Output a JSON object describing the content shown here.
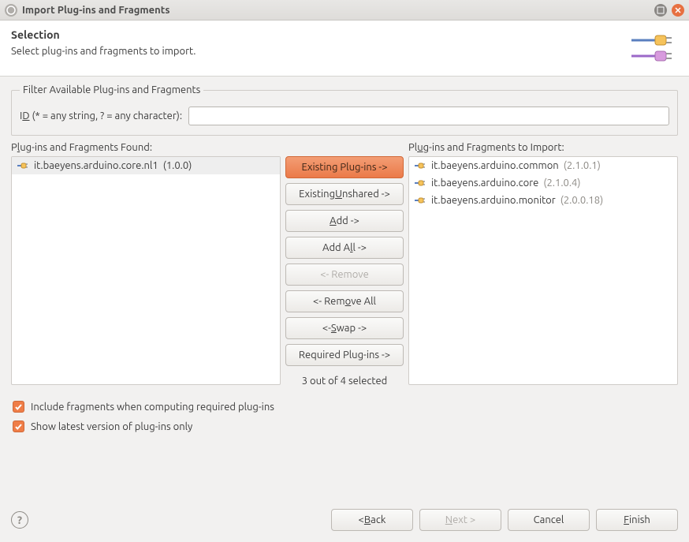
{
  "window": {
    "title": "Import Plug-ins and Fragments"
  },
  "header": {
    "title": "Selection",
    "desc": "Select plug-ins and fragments to import."
  },
  "filter": {
    "legend": "Filter Available Plug-ins and Fragments",
    "id_label_pre": "I",
    "id_label_u": "D",
    "id_label_post": " (* = any string, ? = any character):",
    "value": ""
  },
  "left": {
    "label_pre": "P",
    "label_u": "l",
    "label_post": "ug-ins and Fragments Found:",
    "items": [
      {
        "name": "it.baeyens.arduino.core.nl1",
        "version": "(1.0.0)",
        "selected": true
      }
    ]
  },
  "right": {
    "label_pre": "Pl",
    "label_u": "u",
    "label_post": "g-ins and Fragments to Import:",
    "items": [
      {
        "name": "it.baeyens.arduino.common",
        "version": "(2.1.0.1)"
      },
      {
        "name": "it.baeyens.arduino.core",
        "version": "(2.1.0.4)"
      },
      {
        "name": "it.baeyens.arduino.monitor",
        "version": "(2.0.0.18)"
      }
    ]
  },
  "buttons": {
    "existing": "Existing Plug-ins ->",
    "unshared_pre": "Existing ",
    "unshared_u": "U",
    "unshared_post": "nshared ->",
    "add_u": "A",
    "add_post": "dd ->",
    "addall_pre": "Add A",
    "addall_u": "l",
    "addall_post": "l ->",
    "remove": "<- Remove",
    "removeall_pre": "<- Rem",
    "removeall_u": "o",
    "removeall_post": "ve All",
    "swap_pre": "<- ",
    "swap_u": "S",
    "swap_post": "wap ->",
    "required": "Required Plug-ins ->",
    "status": "3 out of 4 selected"
  },
  "checks": {
    "fragments": "Include fragments when computing required plug-ins",
    "latest": "Show latest version of plug-ins only"
  },
  "footer": {
    "back_pre": "< ",
    "back_u": "B",
    "back_post": "ack",
    "next_u": "N",
    "next_post": "ext >",
    "cancel": "Cancel",
    "finish_u": "F",
    "finish_post": "inish"
  }
}
